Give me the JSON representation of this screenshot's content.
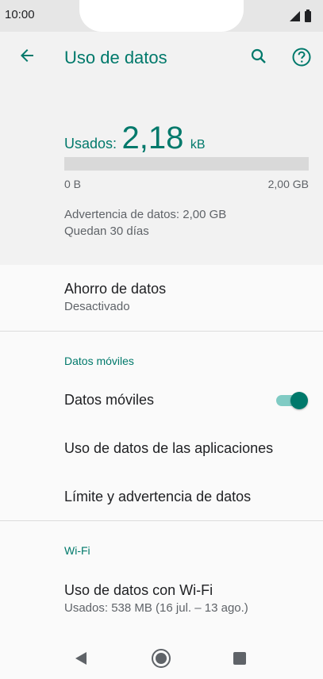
{
  "status_bar": {
    "time": "10:00",
    "icons": [
      "signal-icon",
      "battery-icon"
    ]
  },
  "app_bar": {
    "title": "Uso de datos",
    "back_icon": "arrow-back-icon",
    "search_icon": "search-icon",
    "help_icon": "help-circle-icon",
    "accent_color": "#00796b"
  },
  "summary": {
    "used_label": "Usados:",
    "used_value": "2,18",
    "used_unit": "kB",
    "bar_min": "0 B",
    "bar_max": "2,00 GB",
    "bar_fill_fraction": 0.0,
    "warning": "Advertencia de datos: 2,00 GB",
    "days_left": "Quedan 30 días"
  },
  "data_saver": {
    "title": "Ahorro de datos",
    "status": "Desactivado"
  },
  "mobile_section": {
    "header": "Datos móviles",
    "mobile_data": {
      "label": "Datos móviles",
      "enabled": true
    },
    "app_usage": "Uso de datos de las aplicaciones",
    "limit_warning": "Límite y advertencia de datos"
  },
  "wifi_section": {
    "header": "Wi-Fi",
    "wifi_usage": {
      "title": "Uso de datos con Wi-Fi",
      "subtitle": "Usados: 538 MB (16 jul. – 13 ago.)"
    }
  },
  "nav_bar": {
    "buttons": [
      "back-triangle-icon",
      "home-circle-icon",
      "recents-square-icon"
    ]
  }
}
